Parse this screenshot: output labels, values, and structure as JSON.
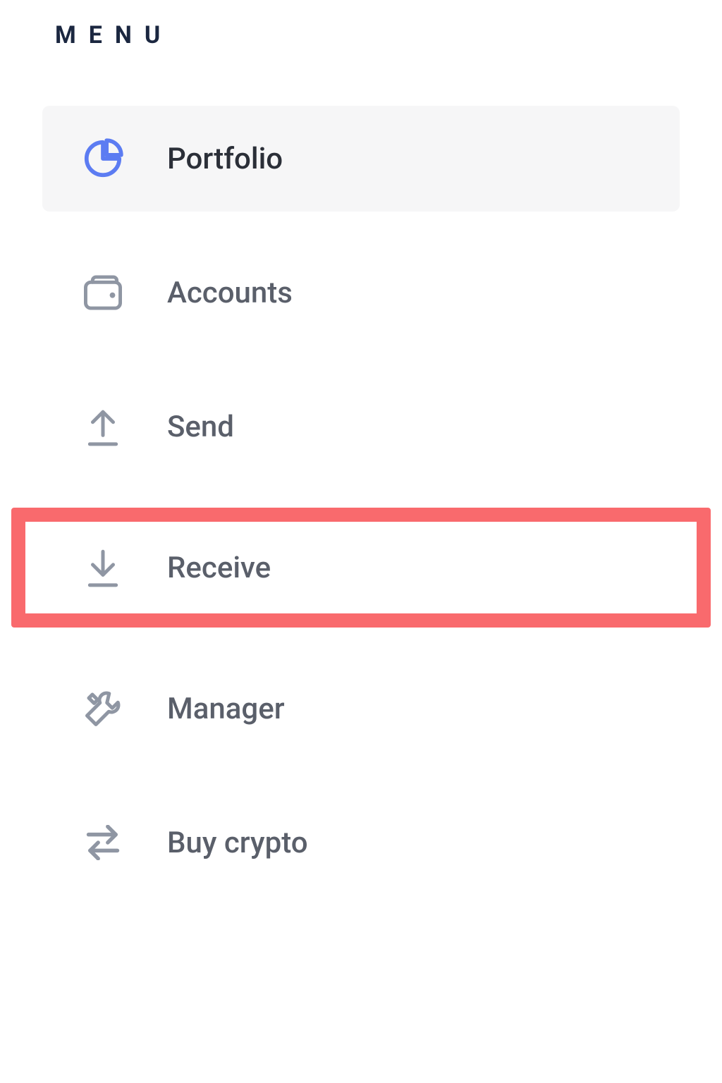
{
  "sidebar": {
    "heading": "MENU",
    "items": [
      {
        "label": "Portfolio"
      },
      {
        "label": "Accounts"
      },
      {
        "label": "Send"
      },
      {
        "label": "Receive"
      },
      {
        "label": "Manager"
      },
      {
        "label": "Buy crypto"
      }
    ]
  },
  "colors": {
    "accent": "#5c7cf2",
    "icon": "#8f96a3",
    "highlight": "#f96a6d"
  }
}
